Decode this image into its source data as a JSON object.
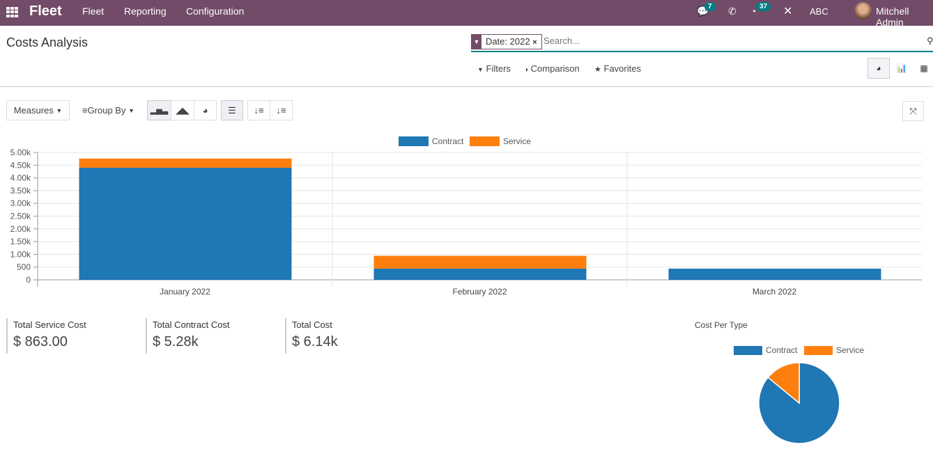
{
  "navbar": {
    "app": "Fleet",
    "menus": [
      "Fleet",
      "Reporting",
      "Configuration"
    ],
    "messages_count": "7",
    "activity_count": "37",
    "company": "ABC",
    "user": "Mitchell Admin"
  },
  "page": {
    "title": "Costs Analysis"
  },
  "search": {
    "facet": "Date: 2022",
    "placeholder": "Search...",
    "filters": "Filters",
    "comparison": "Comparison",
    "favorites": "Favorites"
  },
  "toolbar": {
    "measures": "Measures",
    "group_by": "Group By"
  },
  "colors": {
    "contract": "#1f77b4",
    "service": "#ff7f0e",
    "brand": "#714B67",
    "accent": "#017e84"
  },
  "chart_data": [
    {
      "type": "bar",
      "stacked": true,
      "categories": [
        "January 2022",
        "February 2022",
        "March 2022"
      ],
      "series": [
        {
          "name": "Contract",
          "values": [
            4400,
            440,
            440
          ]
        },
        {
          "name": "Service",
          "values": [
            360,
            503,
            0
          ]
        }
      ],
      "ylim": [
        0,
        5000
      ],
      "yticks": [
        "0",
        "500",
        "1.00k",
        "1.50k",
        "2.00k",
        "2.50k",
        "3.00k",
        "3.50k",
        "4.00k",
        "4.50k",
        "5.00k"
      ],
      "grid": true,
      "legend": "top"
    },
    {
      "type": "pie",
      "title": "Cost Per Type",
      "labels": [
        "Contract",
        "Service"
      ],
      "values": [
        5280,
        863
      ],
      "legend": "top"
    }
  ],
  "kpis": [
    {
      "label": "Total Service Cost",
      "value": "$ 863.00"
    },
    {
      "label": "Total Contract Cost",
      "value": "$ 5.28k"
    },
    {
      "label": "Total Cost",
      "value": "$ 6.14k"
    }
  ]
}
